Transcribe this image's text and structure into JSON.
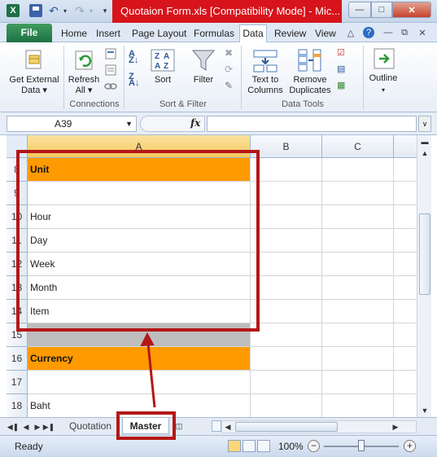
{
  "window": {
    "title": "Quotaion Form.xls  [Compatibility Mode]  -  Mic..."
  },
  "ribbon_tabs": [
    "File",
    "Home",
    "Insert",
    "Page Layout",
    "Formulas",
    "Data",
    "Review",
    "View"
  ],
  "active_tab": "Data",
  "ribbon": {
    "get_external_data": {
      "line1": "Get External",
      "line2": "Data ▾"
    },
    "refresh_all": {
      "line1": "Refresh",
      "line2": "All ▾"
    },
    "connections_group": "Connections",
    "sort": "Sort",
    "filter": "Filter",
    "sort_filter_group": "Sort & Filter",
    "text_to_columns": {
      "line1": "Text to",
      "line2": "Columns"
    },
    "remove_duplicates": {
      "line1": "Remove",
      "line2": "Duplicates"
    },
    "data_tools_group": "Data Tools",
    "outline": "Outline",
    "accent_color": "#1e7145"
  },
  "formula_bar": {
    "name_box": "A39",
    "fx": "fx",
    "formula": ""
  },
  "grid": {
    "columns": [
      "A",
      "B",
      "C"
    ],
    "selected_column": "A",
    "rows": [
      {
        "num": "8",
        "a": "Unit",
        "style": "orange"
      },
      {
        "num": "9",
        "a": "",
        "style": ""
      },
      {
        "num": "10",
        "a": "Hour",
        "style": ""
      },
      {
        "num": "11",
        "a": "Day",
        "style": ""
      },
      {
        "num": "12",
        "a": "Week",
        "style": ""
      },
      {
        "num": "13",
        "a": "Month",
        "style": ""
      },
      {
        "num": "14",
        "a": "Item",
        "style": ""
      },
      {
        "num": "15",
        "a": "",
        "style": "gray"
      },
      {
        "num": "16",
        "a": "Currency",
        "style": "orange"
      },
      {
        "num": "17",
        "a": "",
        "style": ""
      },
      {
        "num": "18",
        "a": "Baht",
        "style": ""
      }
    ]
  },
  "sheets": {
    "tabs": [
      "Quotation",
      "Master"
    ],
    "active": "Master"
  },
  "status": {
    "text": "Ready",
    "zoom": "100%"
  },
  "annotation_color": "#b41717"
}
